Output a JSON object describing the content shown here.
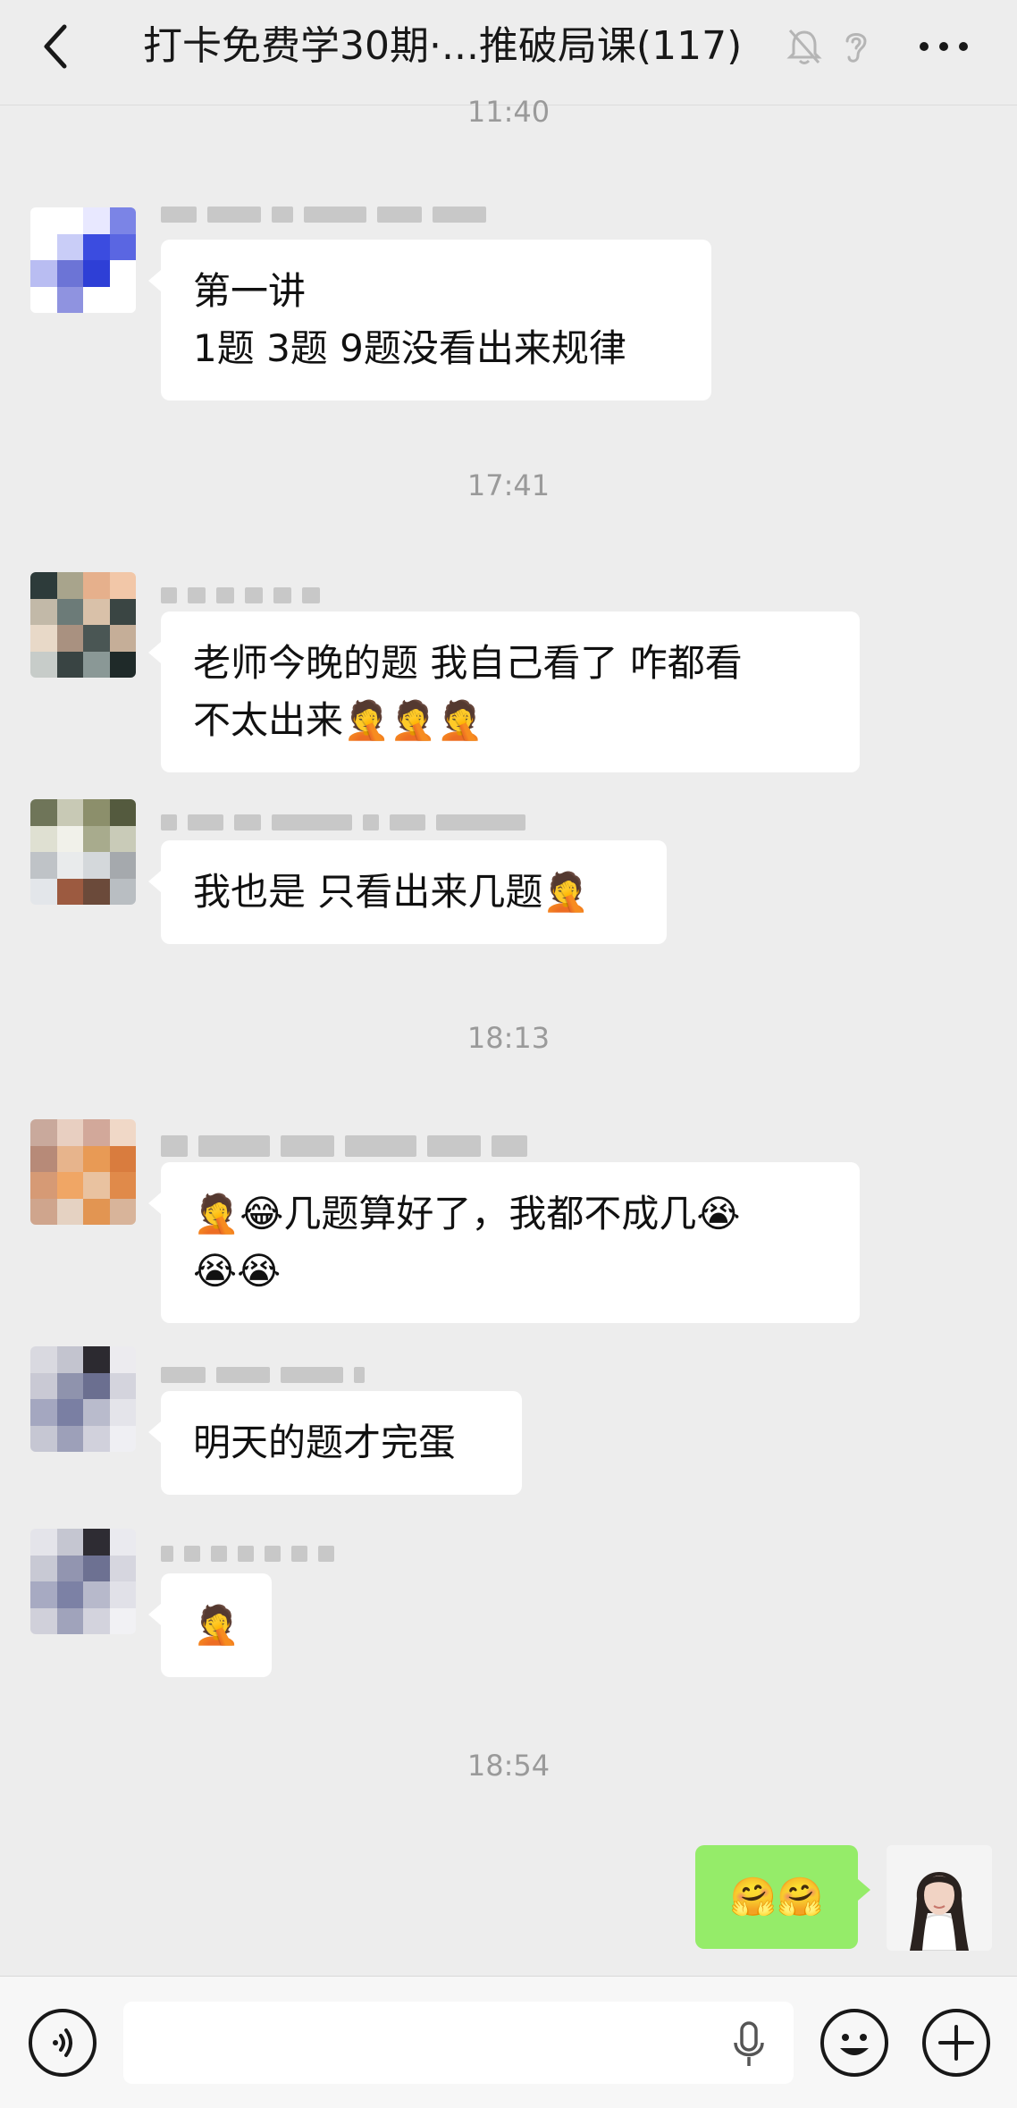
{
  "header": {
    "title": "打卡免费学30期·...推破局课(117)",
    "back_icon": "chevron-left-icon",
    "mute_icon": "bell-off-icon",
    "ear_icon": "ear-icon",
    "more_icon": "more-horizontal-icon"
  },
  "timestamps": [
    "11:40",
    "17:41",
    "18:13",
    "18:54"
  ],
  "messages": [
    {
      "text": "第一讲\n1题 3题 9题没看出来规律"
    },
    {
      "text": "老师今晚的题 我自己看了 咋都看\n不太出来🤦🤦🤦"
    },
    {
      "text": "我也是 只看出来几题🤦"
    },
    {
      "text": "🤦😂几题算好了，我都不成几😭\n😭😭"
    },
    {
      "text": "明天的题才完蛋"
    },
    {
      "text": "🤦"
    }
  ],
  "outgoing": {
    "text": "🤗🤗"
  },
  "bottom_bar": {
    "voice_icon": "voice-icon",
    "mic_icon": "microphone-icon",
    "emoji_icon": "emoji-icon",
    "plus_icon": "plus-icon"
  },
  "colors": {
    "background": "#ededed",
    "bubble_in": "#ffffff",
    "bubble_out": "#95ec69",
    "timestamp": "#9a9a9a"
  }
}
